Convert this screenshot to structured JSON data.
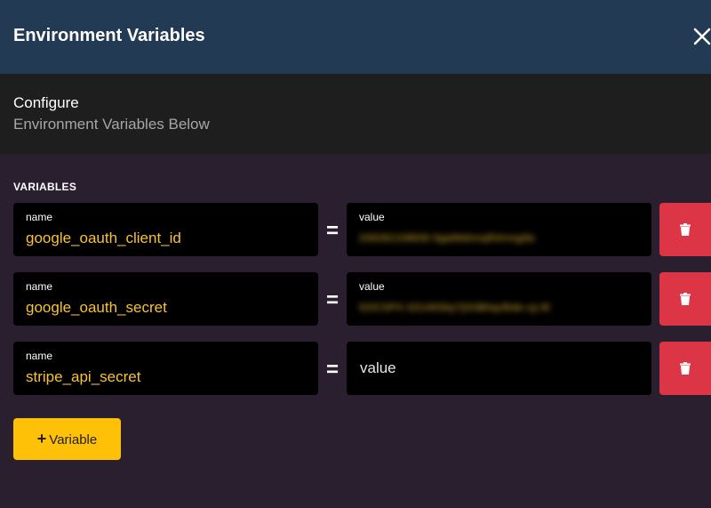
{
  "header": {
    "title": "Environment Variables",
    "close_icon": "close-icon"
  },
  "subheader": {
    "title": "Configure",
    "description": "Environment Variables Below"
  },
  "section": {
    "label": "VARIABLES"
  },
  "rows": [
    {
      "name_label": "name",
      "name_value": "google_oauth_client_id",
      "value_label": "value",
      "value_value": "208282108836-5ga6kblnvql54rnsg9a",
      "value_blurred": true
    },
    {
      "name_label": "name",
      "name_value": "google_oauth_secret",
      "value_label": "value",
      "value_value": "GOCSPX-SZz46Sby7jSSBhqufkde-cp.M",
      "value_blurred": true
    },
    {
      "name_label": "name",
      "name_value": "stripe_api_secret",
      "value_placeholder": "value",
      "value_blurred": false
    }
  ],
  "equals_sign": "=",
  "add_button": {
    "plus": "+",
    "label": "Variable"
  },
  "colors": {
    "header_bg": "#223a53",
    "subheader_bg": "#1e1e1f",
    "main_bg": "#2a1f2e",
    "accent": "#ffc107",
    "value_text": "#f7c233",
    "danger": "#dc3545"
  }
}
